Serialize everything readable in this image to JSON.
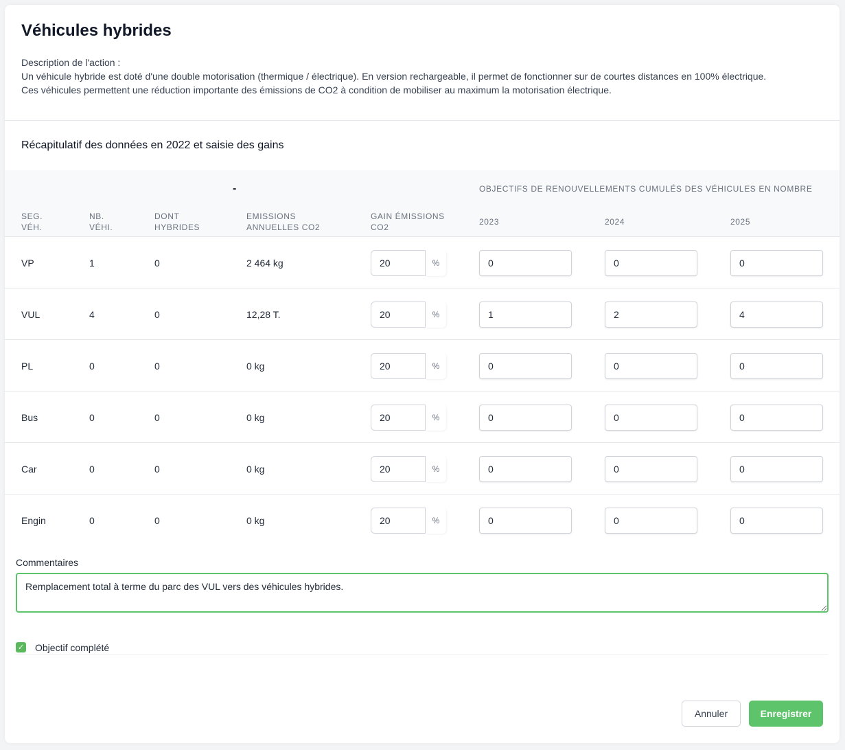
{
  "title": "Véhicules hybrides",
  "description": {
    "label": "Description de l'action :",
    "line1": "Un véhicule hybride est doté d'une double motorisation (thermique / électrique). En version rechargeable, il permet de fonctionner sur de courtes distances en 100% électrique.",
    "line2": "Ces véhicules permettent une réduction importante des émissions de CO2 à condition de mobiliser au maximum la motorisation électrique."
  },
  "subtitle": "Récapitulatif des données en 2022 et saisie des gains",
  "table": {
    "group_left": "-",
    "group_right": "OBJECTIFS DE RENOUVELLEMENTS CUMULÉS DES VÉHICULES EN NOMBRE",
    "headers": {
      "seg_1": "SEG.",
      "seg_2": "VÉH.",
      "nb_1": "NB.",
      "nb_2": "VÉHI.",
      "hyb_1": "DONT",
      "hyb_2": "HYBRIDES",
      "em_1": "EMISSIONS",
      "em_2": "ANNUELLES CO2",
      "gain_1": "GAIN ÉMISSIONS",
      "gain_2": "CO2",
      "y2023": "2023",
      "y2024": "2024",
      "y2025": "2025"
    },
    "unit": "%",
    "rows": [
      {
        "seg": "VP",
        "nb": "1",
        "hybrides": "0",
        "emissions": "2 464 kg",
        "gain": "20",
        "y2023": "0",
        "y2024": "0",
        "y2025": "0"
      },
      {
        "seg": "VUL",
        "nb": "4",
        "hybrides": "0",
        "emissions": "12,28 T.",
        "gain": "20",
        "y2023": "1",
        "y2024": "2",
        "y2025": "4"
      },
      {
        "seg": "PL",
        "nb": "0",
        "hybrides": "0",
        "emissions": "0 kg",
        "gain": "20",
        "y2023": "0",
        "y2024": "0",
        "y2025": "0"
      },
      {
        "seg": "Bus",
        "nb": "0",
        "hybrides": "0",
        "emissions": "0 kg",
        "gain": "20",
        "y2023": "0",
        "y2024": "0",
        "y2025": "0"
      },
      {
        "seg": "Car",
        "nb": "0",
        "hybrides": "0",
        "emissions": "0 kg",
        "gain": "20",
        "y2023": "0",
        "y2024": "0",
        "y2025": "0"
      },
      {
        "seg": "Engin",
        "nb": "0",
        "hybrides": "0",
        "emissions": "0 kg",
        "gain": "20",
        "y2023": "0",
        "y2024": "0",
        "y2025": "0"
      }
    ]
  },
  "comments": {
    "label": "Commentaires",
    "value": "Remplacement total à terme du parc des VUL vers des véhicules hybrides."
  },
  "objective": {
    "label": "Objectif complété",
    "checked": true
  },
  "buttons": {
    "cancel": "Annuler",
    "save": "Enregistrer"
  },
  "colors": {
    "accent": "#5ec46b",
    "checkbox": "#5cb85c"
  }
}
